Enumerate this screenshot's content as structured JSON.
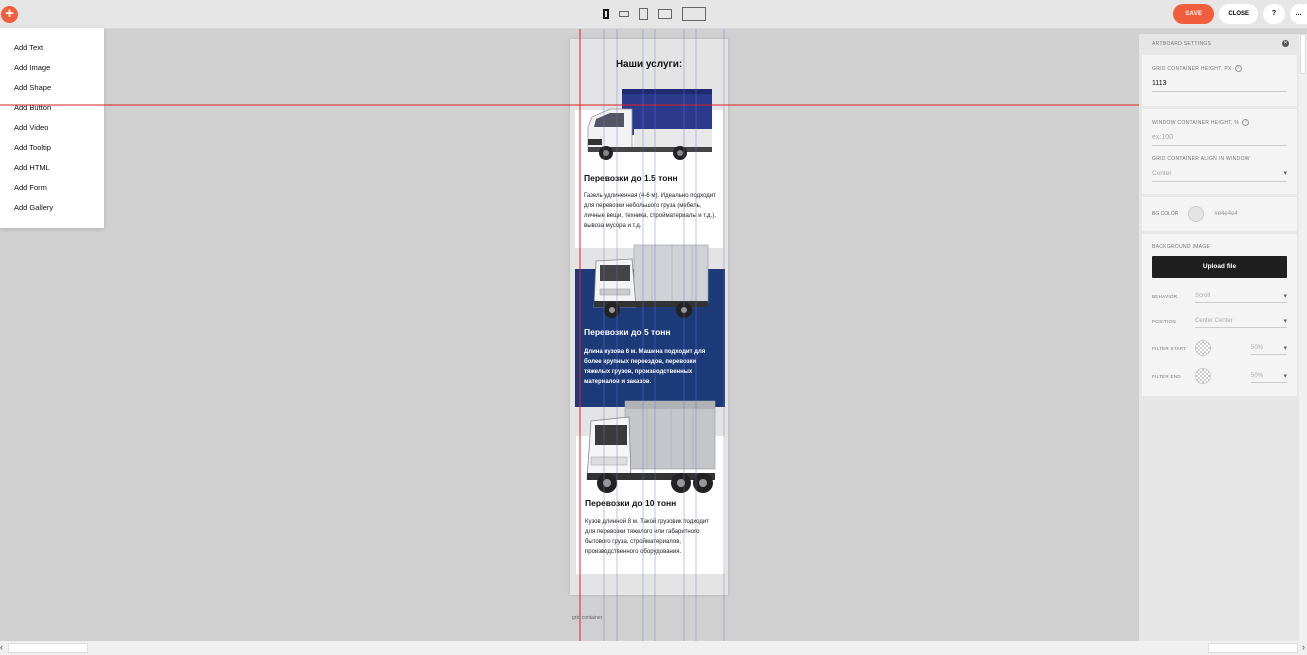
{
  "topbar": {
    "add_symbol": "+",
    "save_label": "SAVE",
    "close_label": "CLOSE",
    "help_label": "?",
    "more_label": "..."
  },
  "add_menu": {
    "items": [
      "Add Text",
      "Add Image",
      "Add Shape",
      "Add Button",
      "Add Video",
      "Add Tooltip",
      "Add HTML",
      "Add Form",
      "Add Gallery"
    ]
  },
  "artboard": {
    "title": "Наши услуги:",
    "grid_label": "grid container",
    "cards": [
      {
        "title": "Перевозки до 1.5 тонн",
        "text": "Газель удлиненная (4-6 м). Идеально подходит для перевозки небольшого груза (мебель, личные вещи, техника, стройматериалы и т.д.), вывоза мусора и т.д."
      },
      {
        "title": "Перевозки до 5 тонн",
        "text": "Длина кузова 6 м. Машина подходит для более крупных переездов, перевозки тяжелых грузов, производственных материалов и заказов."
      },
      {
        "title": "Перевозки до 10 тонн",
        "text": "Кузов длинной 8 м. Такой грузовик подходит для перевозки тяжелого или габаритного бытового груза, стройматериалов, производственного оборудования."
      }
    ]
  },
  "panel": {
    "header": "ARTBOARD SETTINGS",
    "grid_height_label": "GRID CONTAINER HEIGHT, PX",
    "grid_height_value": "1113",
    "window_height_label": "WINDOW CONTAINER HEIGHT, %",
    "window_height_placeholder": "ex:100",
    "align_label": "GRID CONTAINER ALIGN IN WINDOW",
    "align_value": "Center",
    "bg_color_label": "BG COLOR",
    "bg_color_value": "#e4e4e4",
    "bg_image_label": "BACKGROUND IMAGE",
    "upload_label": "Upload file",
    "behavior_label": "BEHAVIOR",
    "behavior_value": "Scroll",
    "position_label": "POSITION",
    "position_value": "Center Center",
    "filter_start_label": "FILTER START",
    "filter_start_value": "50%",
    "filter_end_label": "FILTER END",
    "filter_end_value": "50%"
  },
  "colors": {
    "accent": "#f15e3e",
    "card_blue": "#1c3a78",
    "guide_red": "#e02020",
    "guide_blue": "#6f6fe0"
  }
}
